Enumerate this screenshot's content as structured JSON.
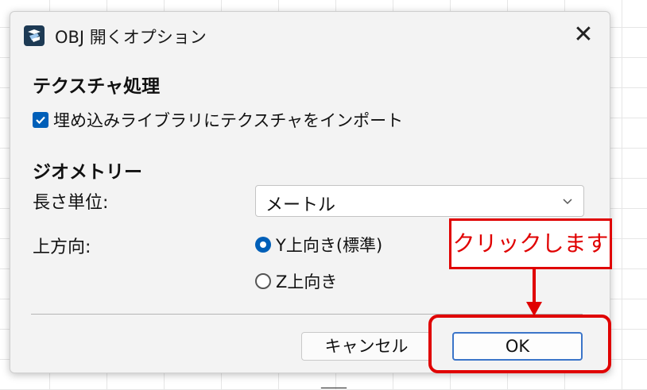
{
  "dialog": {
    "title": "OBJ 開くオプション",
    "close_label": "✕",
    "texture_section": {
      "title": "テクスチャ処理",
      "import_checkbox": {
        "label": "埋め込みライブラリにテクスチャをインポート",
        "checked": true
      }
    },
    "geometry_section": {
      "title": "ジオメトリー",
      "length_unit": {
        "label": "長さ単位:",
        "value": "メートル"
      },
      "up_direction": {
        "label": "上方向:",
        "options": [
          {
            "label": "Y上向き(標準)",
            "checked": true
          },
          {
            "label": "Z上向き",
            "checked": false
          }
        ]
      }
    },
    "buttons": {
      "cancel": "キャンセル",
      "ok": "OK"
    }
  },
  "annotation": {
    "callout_text": "クリックします",
    "color": "#e00000"
  },
  "background_fragment": "____"
}
